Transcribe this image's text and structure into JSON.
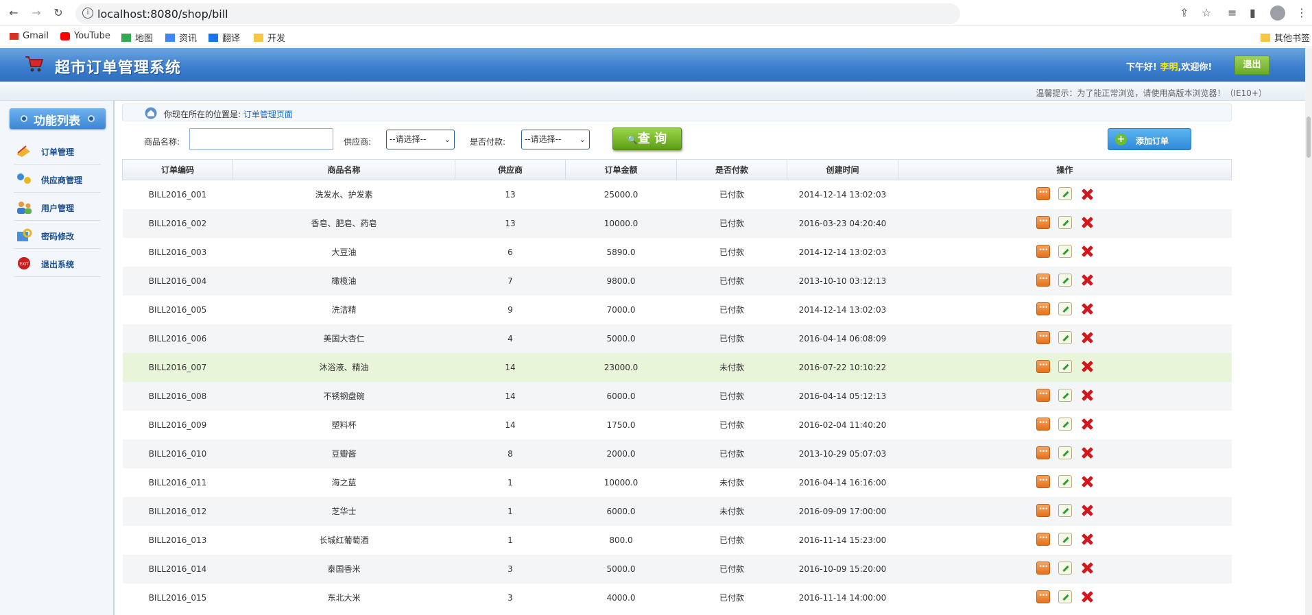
{
  "browser": {
    "url": "localhost:8080/shop/bill",
    "bookmarks": [
      "Gmail",
      "YouTube",
      "地图",
      "资讯",
      "翻译",
      "开发"
    ],
    "other_bookmarks": "其他书签"
  },
  "header": {
    "title": "超市订单管理系统",
    "greeting_prefix": "下午好!",
    "username": "李明",
    "greeting_suffix": ",欢迎你!",
    "logout_label": "退出"
  },
  "tip": "温馨提示：为了能正常浏览，请使用高版本浏览器！（IE10+）",
  "sidebar": {
    "title": "功能列表",
    "items": [
      {
        "label": "订单管理",
        "icon": "order-icon"
      },
      {
        "label": "供应商管理",
        "icon": "supplier-icon"
      },
      {
        "label": "用户管理",
        "icon": "user-icon"
      },
      {
        "label": "密码修改",
        "icon": "password-icon"
      },
      {
        "label": "退出系统",
        "icon": "exit-icon"
      }
    ]
  },
  "breadcrumb": {
    "prefix": "你现在所在的位置是:",
    "current": "订单管理页面"
  },
  "search": {
    "product_label": "商品名称:",
    "product_value": "",
    "provider_label": "供应商:",
    "provider_selected": "--请选择--",
    "payment_label": "是否付款:",
    "payment_selected": "--请选择--",
    "query_label": "查 询",
    "add_label": "添加订单"
  },
  "table": {
    "headers": [
      "订单编码",
      "商品名称",
      "供应商",
      "订单金额",
      "是否付款",
      "创建时间",
      "操作"
    ],
    "rows": [
      [
        "BILL2016_001",
        "洗发水、护发素",
        "13",
        "25000.0",
        "已付款",
        "2014-12-14 13:02:03"
      ],
      [
        "BILL2016_002",
        "香皂、肥皂、药皂",
        "13",
        "10000.0",
        "已付款",
        "2016-03-23 04:20:40"
      ],
      [
        "BILL2016_003",
        "大豆油",
        "6",
        "5890.0",
        "已付款",
        "2014-12-14 13:02:03"
      ],
      [
        "BILL2016_004",
        "橄榄油",
        "7",
        "9800.0",
        "已付款",
        "2013-10-10 03:12:13"
      ],
      [
        "BILL2016_005",
        "洗洁精",
        "9",
        "7000.0",
        "已付款",
        "2014-12-14 13:02:03"
      ],
      [
        "BILL2016_006",
        "美国大杏仁",
        "4",
        "5000.0",
        "已付款",
        "2016-04-14 06:08:09"
      ],
      [
        "BILL2016_007",
        "沐浴液、精油",
        "14",
        "23000.0",
        "未付款",
        "2016-07-22 10:10:22"
      ],
      [
        "BILL2016_008",
        "不锈钢盘碗",
        "14",
        "6000.0",
        "已付款",
        "2016-04-14 05:12:13"
      ],
      [
        "BILL2016_009",
        "塑料杯",
        "14",
        "1750.0",
        "已付款",
        "2016-02-04 11:40:20"
      ],
      [
        "BILL2016_010",
        "豆瓣酱",
        "8",
        "2000.0",
        "已付款",
        "2013-10-29 05:07:03"
      ],
      [
        "BILL2016_011",
        "海之蓝",
        "1",
        "10000.0",
        "未付款",
        "2016-04-14 16:16:00"
      ],
      [
        "BILL2016_012",
        "芝华士",
        "1",
        "6000.0",
        "未付款",
        "2016-09-09 17:00:00"
      ],
      [
        "BILL2016_013",
        "长城红葡萄酒",
        "1",
        "800.0",
        "已付款",
        "2016-11-14 15:23:00"
      ],
      [
        "BILL2016_014",
        "泰国香米",
        "3",
        "5000.0",
        "已付款",
        "2016-10-09 15:20:00"
      ],
      [
        "BILL2016_015",
        "东北大米",
        "3",
        "4000.0",
        "已付款",
        "2016-11-14 14:00:00"
      ]
    ],
    "highlighted_row": 6
  },
  "colors": {
    "header_blue": "#3d7fcf",
    "accent_green": "#6aab27",
    "delete_red": "#d4171c",
    "highlight_row": "#e8f5d8"
  }
}
